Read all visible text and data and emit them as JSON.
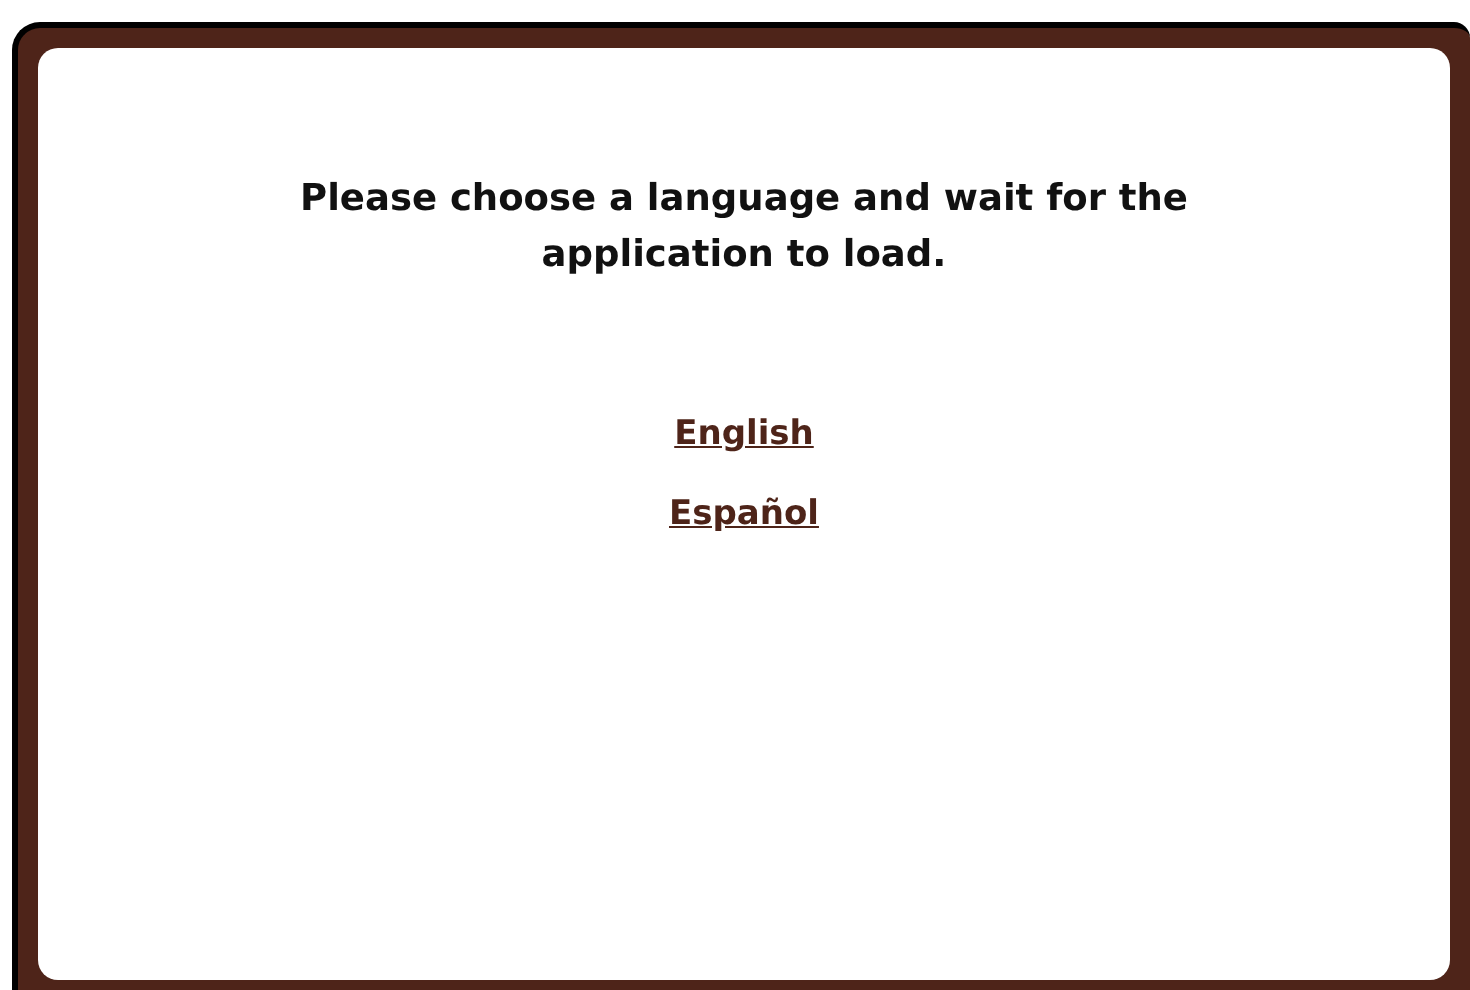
{
  "message": "Please choose a language and wait for the application to load.",
  "languages": [
    {
      "label": "English"
    },
    {
      "label": "Español"
    }
  ]
}
